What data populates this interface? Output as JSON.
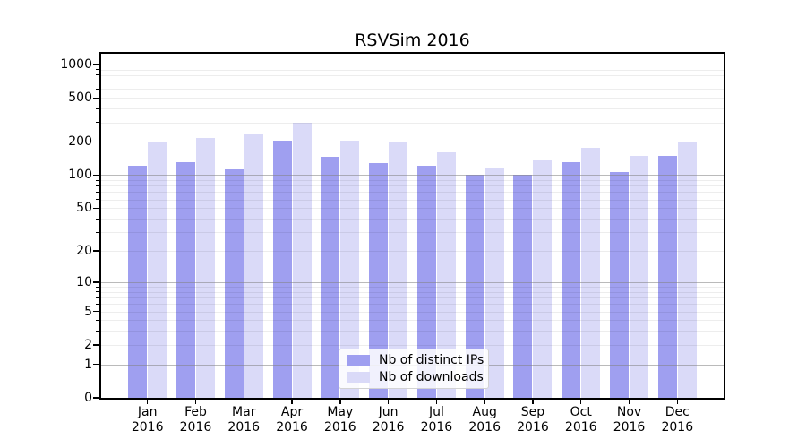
{
  "chart_data": {
    "type": "bar",
    "title": "RSVSim 2016",
    "categories": [
      "Jan",
      "Feb",
      "Mar",
      "Apr",
      "May",
      "Jun",
      "Jul",
      "Aug",
      "Sep",
      "Oct",
      "Nov",
      "Dec"
    ],
    "category_year": "2016",
    "series": [
      {
        "name": "Nb of distinct IPs",
        "color": "#9f9ff0",
        "values": [
          121,
          130,
          113,
          206,
          147,
          128,
          121,
          100,
          100,
          131,
          107,
          150
        ]
      },
      {
        "name": "Nb of downloads",
        "color": "#dadaf8",
        "values": [
          200,
          218,
          238,
          296,
          207,
          200,
          160,
          115,
          136,
          178,
          149,
          202
        ]
      }
    ],
    "yscale": "log1p",
    "ytick_labels": [
      "0",
      "1",
      "2",
      "5",
      "10",
      "20",
      "50",
      "100",
      "200",
      "500",
      "1000"
    ],
    "yticks": [
      0,
      1,
      2,
      5,
      10,
      20,
      50,
      100,
      200,
      500,
      1000
    ],
    "ylim": [
      0,
      1250
    ],
    "grid": "both",
    "legend_position": "lower center"
  },
  "colors": {
    "major_grid": "#b4b4b4",
    "minor_grid": "#ececec",
    "spine": "#000000",
    "background": "#ffffff"
  }
}
